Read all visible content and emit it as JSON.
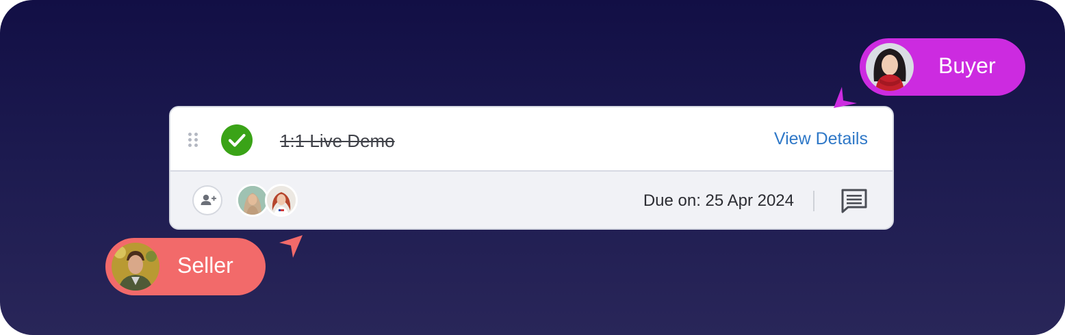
{
  "task": {
    "title": "1:1 Live Demo",
    "completed": true,
    "view_details_label": "View Details",
    "due_label": "Due on: 25 Apr 2024"
  },
  "assignees": {
    "add_icon": "person-add-icon",
    "count": 2
  },
  "icons": {
    "drag": "drag-handle-icon",
    "check": "check-circle-icon",
    "comment": "comment-icon"
  },
  "cursors": {
    "buyer": {
      "label": "Buyer",
      "color": "#cc2be0"
    },
    "seller": {
      "label": "Seller",
      "color": "#f26a6a"
    }
  },
  "colors": {
    "accent_link": "#2f78c7",
    "check_green": "#3aa317",
    "background_top": "#120f45",
    "background_bottom": "#292659"
  }
}
